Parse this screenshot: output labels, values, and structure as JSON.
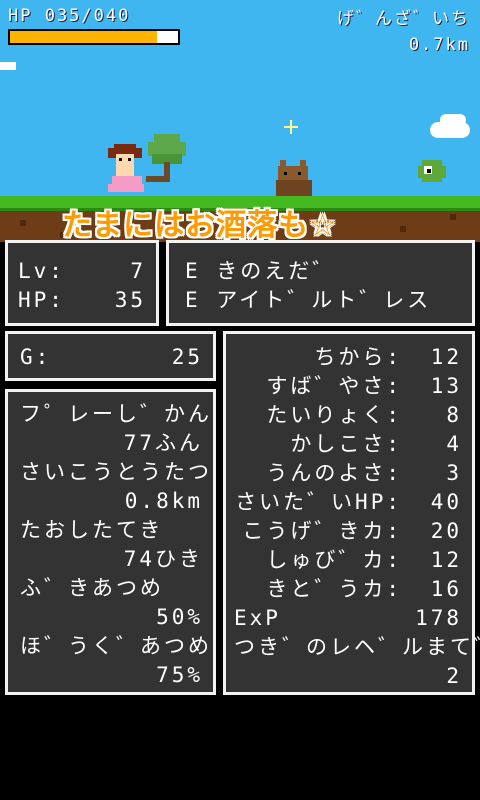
{
  "hud": {
    "hp_text": "HP 035/040",
    "hp_fraction": 0.875,
    "status_label": "げ゛んざ゛いち",
    "distance": "0.7km"
  },
  "banner": "たまにはお酒落も☆",
  "level_panel": {
    "lv_label": "Lv:",
    "lv_value": "7",
    "hp_label": "HP:",
    "hp_value": "35"
  },
  "equip_panel": {
    "weapon": "E きのえだ゛",
    "armor": "E アイト゛ルト゛レス"
  },
  "gold_panel": {
    "label": "G:",
    "value": "25"
  },
  "records": [
    {
      "label": "フ゜レーし゛かん",
      "value": "77ふん"
    },
    {
      "label": "さいこうとうたつ",
      "value": "0.8km"
    },
    {
      "label": "たおしたてき",
      "value": "74ひき"
    },
    {
      "label": "ふ゛きあつめ",
      "value": "50%"
    },
    {
      "label": "ほ゛うく゛あつめ",
      "value": "75%"
    }
  ],
  "stats": [
    {
      "label": "ちから:",
      "value": "12"
    },
    {
      "label": "すば゛やさ:",
      "value": "13"
    },
    {
      "label": "たいりょく:",
      "value": "8"
    },
    {
      "label": "かしこさ:",
      "value": "4"
    },
    {
      "label": "うんのよさ:",
      "value": "3"
    },
    {
      "label": "さいた゛いHP:",
      "value": "40"
    },
    {
      "label": "こうげ゛きカ:",
      "value": "20"
    },
    {
      "label": "しゅび゛カ:",
      "value": "12"
    },
    {
      "label": "きと゛うカ:",
      "value": "16"
    },
    {
      "label": "ExP",
      "value": "178"
    }
  ],
  "next_level": {
    "label": "つき゛のレヘ゛ルまて゛",
    "value": "2"
  },
  "colors": {
    "sky": "#3fb6ef",
    "grass": "#44b81f",
    "dirt": "#6e3d17",
    "panel": "#333333",
    "hp_fill": "#ffb400",
    "banner": "#ff9a00"
  }
}
